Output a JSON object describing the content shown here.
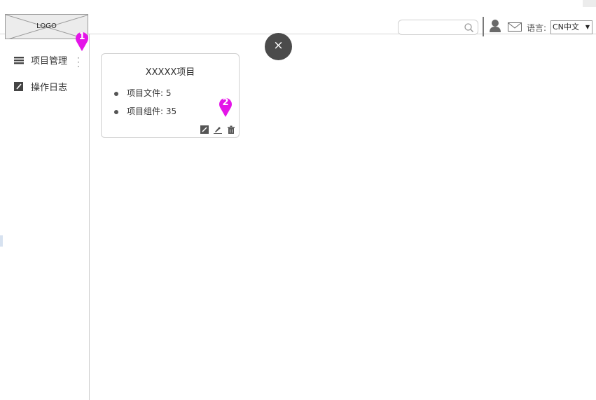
{
  "header": {
    "logo_text": "LOGO",
    "search": {
      "placeholder": ""
    },
    "language_label": "语言:",
    "language_value": "CN中文"
  },
  "sidebar": {
    "items": [
      {
        "label": "项目管理",
        "icon": "list-icon"
      },
      {
        "label": "操作日志",
        "icon": "log-icon"
      }
    ]
  },
  "project_card": {
    "title": "XXXXX项目",
    "rows": [
      {
        "label": "项目文件: 5"
      },
      {
        "label": "项目组件: 35"
      }
    ],
    "actions": [
      "log-icon",
      "edit-icon",
      "delete-icon"
    ]
  },
  "annotations": [
    {
      "number": "1"
    },
    {
      "number": "2"
    }
  ],
  "close_button": {
    "symbol": "×"
  },
  "colors": {
    "annotation_pin": "#e415e8",
    "close_button": "#4b4b4b",
    "logo_bg": "#ececec"
  }
}
